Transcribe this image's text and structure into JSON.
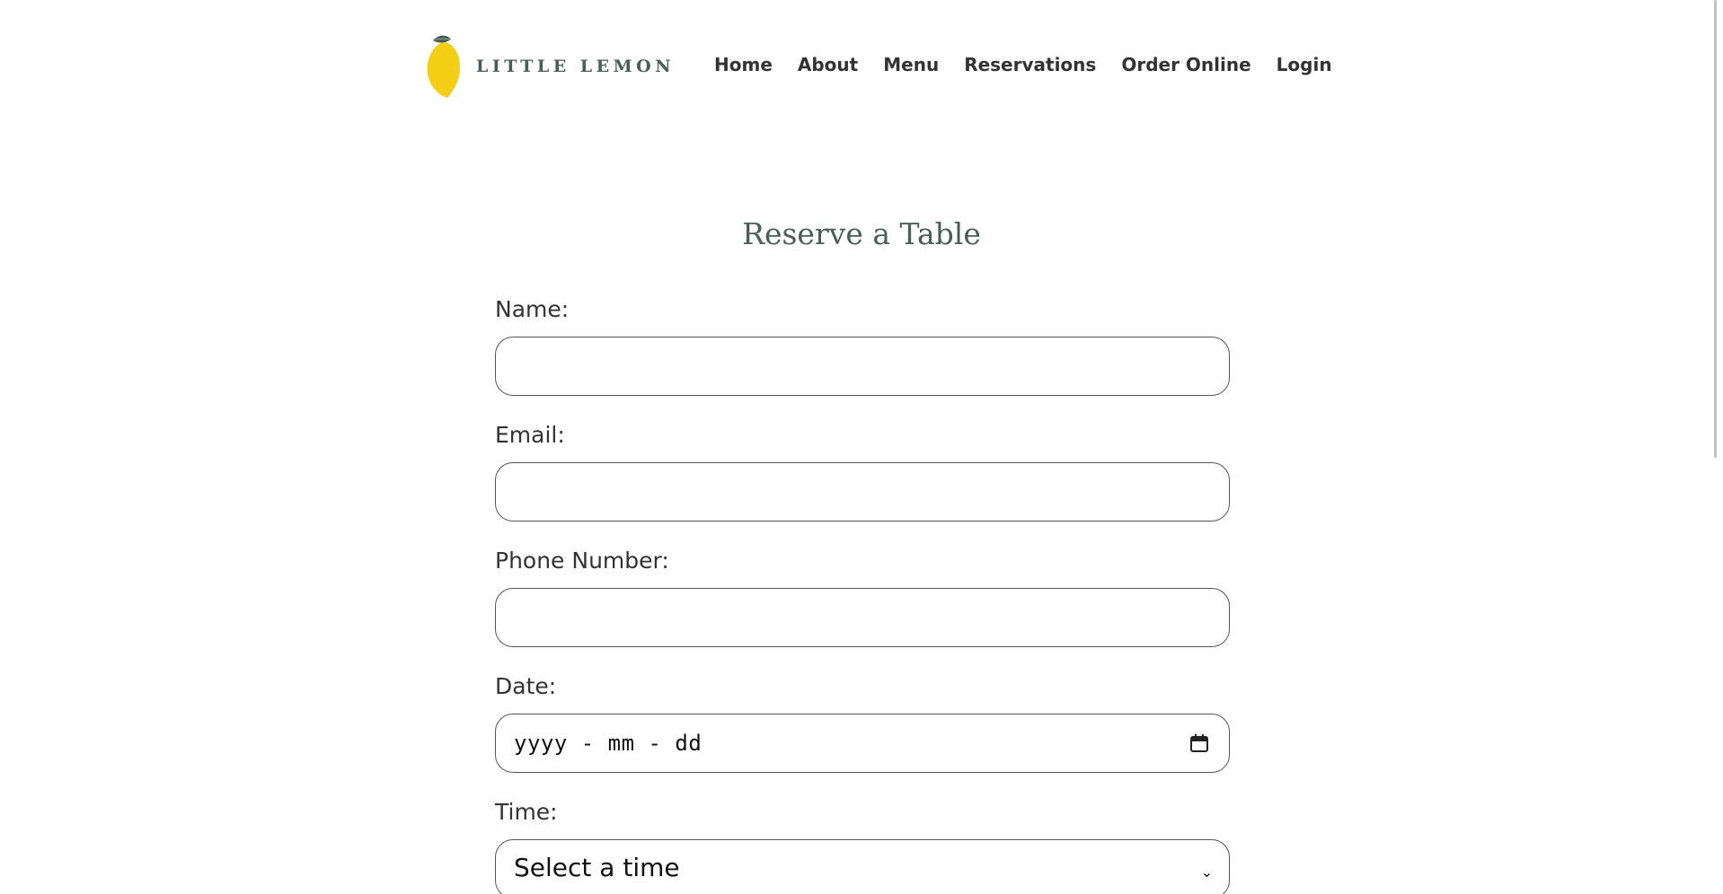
{
  "brand": {
    "name": "LITTLE LEMON",
    "colors": {
      "primary": "#495e57",
      "lemon": "#f4ce14",
      "leaf": "#495e57"
    }
  },
  "nav": {
    "items": [
      {
        "label": "Home"
      },
      {
        "label": "About"
      },
      {
        "label": "Menu"
      },
      {
        "label": "Reservations"
      },
      {
        "label": "Order Online"
      },
      {
        "label": "Login"
      }
    ]
  },
  "form": {
    "title": "Reserve a Table",
    "name": {
      "label": "Name:",
      "value": ""
    },
    "email": {
      "label": "Email:",
      "value": ""
    },
    "phone": {
      "label": "Phone Number:",
      "value": ""
    },
    "date": {
      "label": "Date:",
      "placeholder": "yyyy - mm - dd",
      "icon": "calendar-icon"
    },
    "time": {
      "label": "Time:",
      "selected": "Select a time",
      "icon": "chevron-down-icon"
    }
  }
}
